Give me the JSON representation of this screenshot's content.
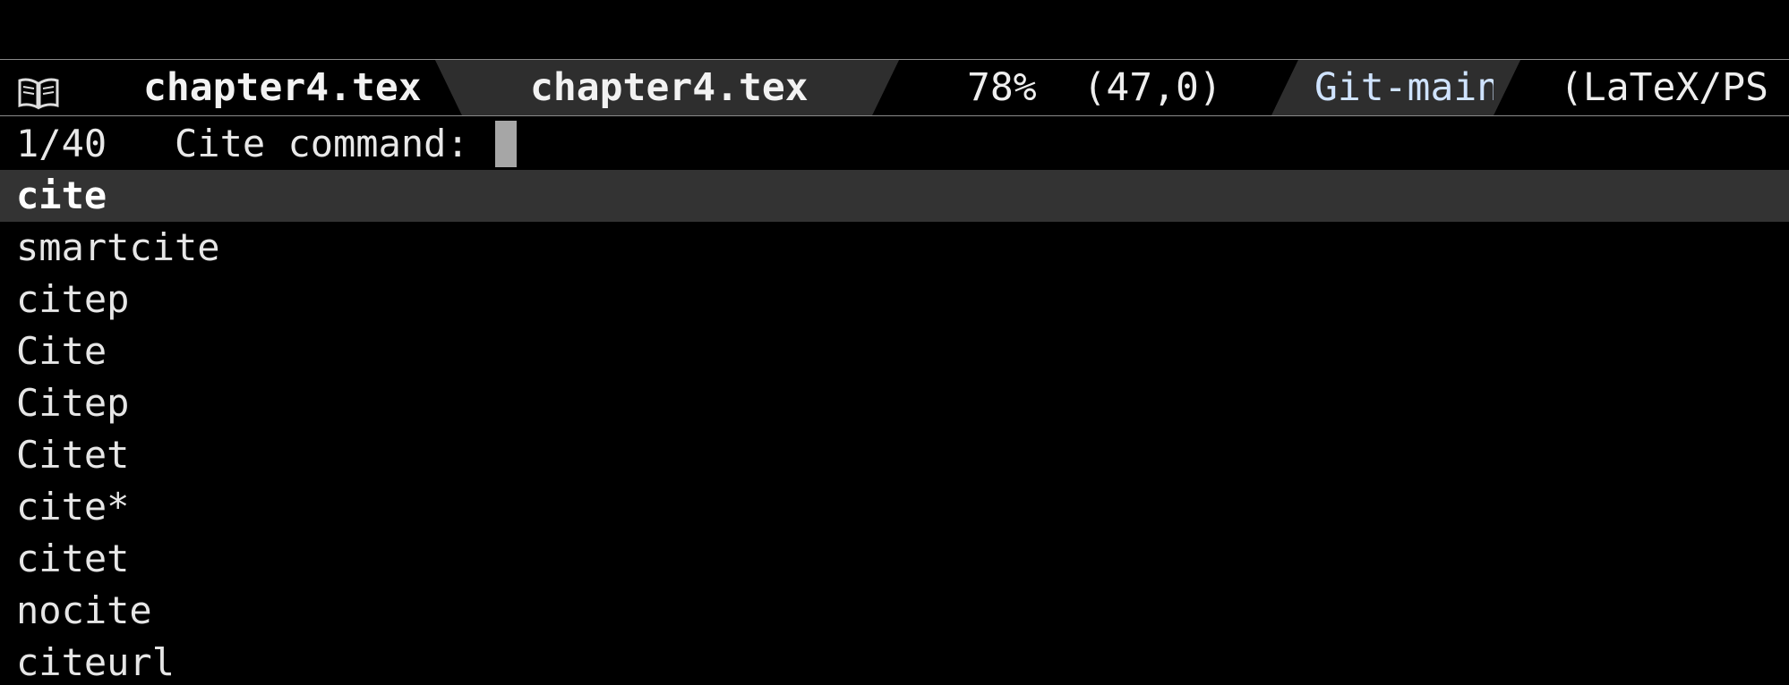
{
  "modeline": {
    "icon": "book-icon",
    "buffer_name_1": "chapter4.tex",
    "buffer_name_2": "chapter4.tex",
    "position": "78%  (47,0)",
    "vcs": "Git-main",
    "mode": "(LaTeX/PS"
  },
  "minibuffer": {
    "count": "1/40",
    "prompt": "Cite command:"
  },
  "candidates": [
    "cite",
    "smartcite",
    "citep",
    "Cite",
    "Citep",
    "Citet",
    "cite*",
    "citet",
    "nocite",
    "citeurl"
  ],
  "colors": {
    "background": "#000000",
    "modeline_bg": "#2e2e2e",
    "selected_bg": "#333333",
    "vcs_text": "#cfe3ff",
    "cursor": "#a6a6a6"
  }
}
